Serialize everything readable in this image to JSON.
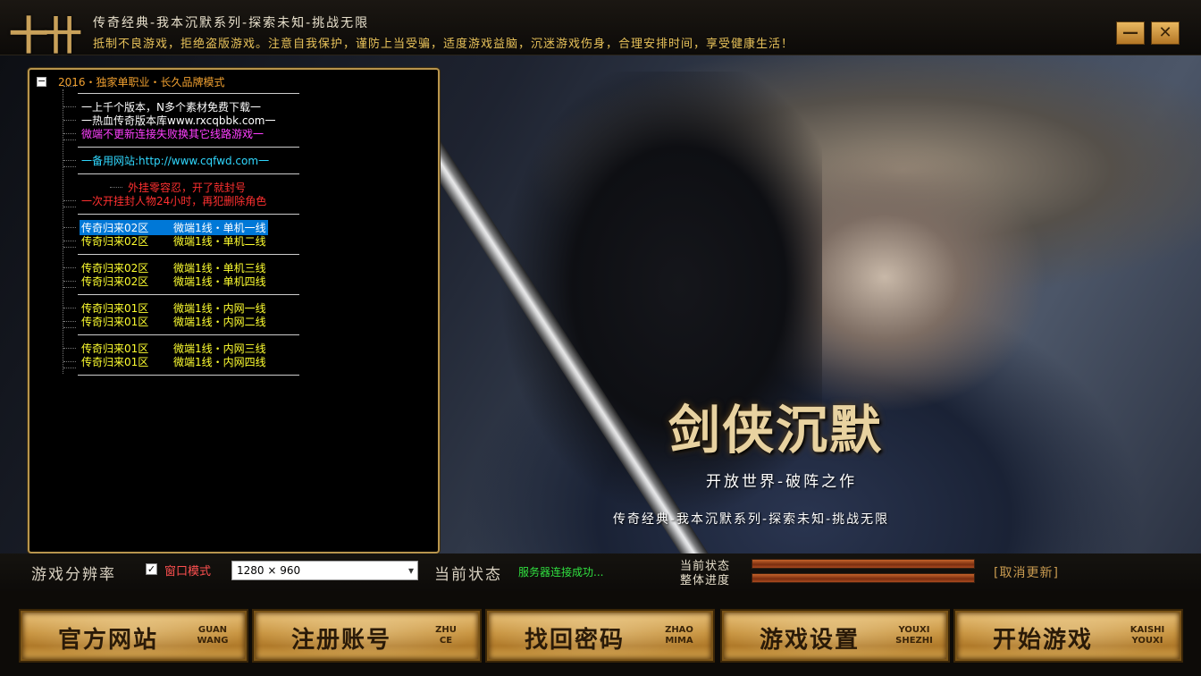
{
  "titlebar": {
    "logo": "十卄",
    "title": "传奇经典-我本沉默系列-探索未知-挑战无限",
    "notice": "抵制不良游戏，拒绝盗版游戏。注意自我保护，谨防上当受骗，适度游戏益脑，沉迷游戏伤身，合理安排时间，享受健康生活！",
    "minimize": "—",
    "close": "✕"
  },
  "tree": {
    "toggle": "−",
    "root": "2016・独家单职业・长久品牌模式",
    "info": [
      {
        "text": "一上千个版本，N多个素材免费下载一",
        "color": "white"
      },
      {
        "text": "一热血传奇版本库www.rxcqbbk.com一",
        "color": "white"
      },
      {
        "text": "微端不更新连接失败换其它线路游戏一",
        "color": "magenta"
      },
      {
        "text": "一备用网站:http://www.cqfwd.com一",
        "color": "cyan"
      },
      {
        "text": "外挂零容忍，开了就封号",
        "color": "red"
      },
      {
        "text": "一次开挂封人物24小时，再犯删除角色",
        "color": "red"
      }
    ],
    "servers": [
      {
        "name": "传奇归来02区",
        "line": "微端1线・单机一线"
      },
      {
        "name": "传奇归来02区",
        "line": "微端1线・单机二线"
      },
      {
        "name": "传奇归来02区",
        "line": "微端1线・单机三线"
      },
      {
        "name": "传奇归来02区",
        "line": "微端1线・单机四线"
      },
      {
        "name": "传奇归来01区",
        "line": "微端1线・内网一线"
      },
      {
        "name": "传奇归来01区",
        "line": "微端1线・内网二线"
      },
      {
        "name": "传奇归来01区",
        "line": "微端1线・内网三线"
      },
      {
        "name": "传奇归来01区",
        "line": "微端1线・内网四线"
      }
    ],
    "selected_index": 0
  },
  "artwork": {
    "title": "剑侠沉默",
    "subtitle": "开放世界-破阵之作",
    "slogan": "传奇经典-我本沉默系列-探索未知-挑战无限"
  },
  "status": {
    "resolution_label": "游戏分辨率",
    "window_mode_label": "窗口模式",
    "window_mode_checked": true,
    "check_mark": "✓",
    "resolution_value": "1280 × 960",
    "dropdown_icon": "chevron-down-icon",
    "state_label": "当前状态",
    "state_value": "服务器连接成功...",
    "current_label": "当前状态",
    "overall_label": "整体进度",
    "current_progress": 1.0,
    "overall_progress": 1.0,
    "cancel_update": "[取消更新]"
  },
  "buttons": [
    {
      "id": "official",
      "label": "官方网站",
      "pinyin1": "GUAN",
      "pinyin2": "WANG"
    },
    {
      "id": "register",
      "label": "注册账号",
      "pinyin1": "ZHU",
      "pinyin2": "CE"
    },
    {
      "id": "recover",
      "label": "找回密码",
      "pinyin1": "ZHAO",
      "pinyin2": "MIMA"
    },
    {
      "id": "settings",
      "label": "游戏设置",
      "pinyin1": "YOUXI",
      "pinyin2": "SHEZHI"
    },
    {
      "id": "start",
      "label": "开始游戏",
      "pinyin1": "KAISHI",
      "pinyin2": "YOUXI"
    }
  ],
  "colors": {
    "gold": "#b8954d",
    "magenta": "#ff40ff",
    "cyan": "#30d8ff",
    "red": "#ff3030",
    "yellow": "#ffff30",
    "success": "#30e040",
    "progress": "#c4622a"
  }
}
